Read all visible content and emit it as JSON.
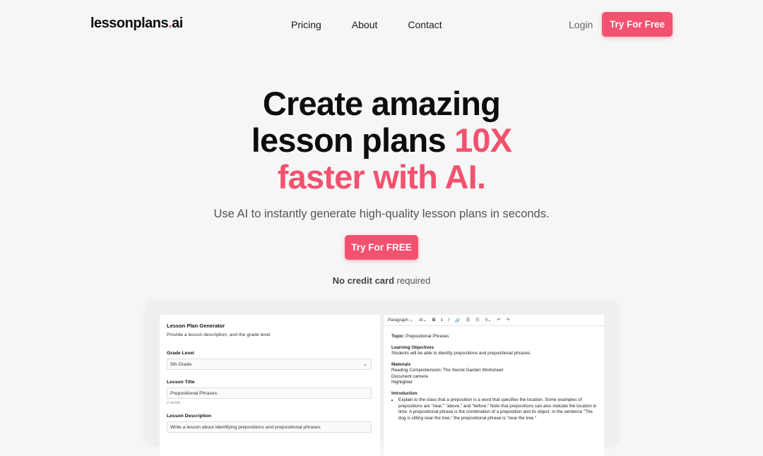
{
  "nav": {
    "logo": "lessonplans",
    "logo_dot": ".",
    "logo_suffix": "ai",
    "links": [
      "Pricing",
      "About",
      "Contact"
    ],
    "login": "Login",
    "cta": "Try For Free"
  },
  "hero": {
    "line1": "Create amazing",
    "line2": "lesson plans ",
    "accent1": "10X",
    "accent2": "faster with AI.",
    "subtitle": "Use AI to instantly generate high-quality lesson plans in seconds.",
    "cta": "Try For FREE",
    "note_bold": "No credit card",
    "note_rest": " required"
  },
  "colors": {
    "accent": "#f2526f"
  },
  "preview": {
    "form": {
      "title": "Lesson Plan Generator",
      "subtitle": "Provide a lesson description, and the grade level",
      "grade_label": "Grade Level",
      "grade_value": "5th Grade",
      "title_label": "Lesson Title",
      "title_value": "Prepositional Phrases",
      "word_count": "2 words",
      "desc_label": "Lesson Description",
      "desc_value": "Write a lesson about identifying prepositions and prepositional phrases"
    },
    "editor": {
      "toolbar": [
        "Paragraph",
        "AI",
        "B",
        "I",
        "I",
        "link-icon",
        "list-icon",
        "numbered-list-icon",
        "align-icon",
        "undo-icon",
        "redo-icon"
      ],
      "paragraph_label": "Paragraph",
      "ai_label": "AI",
      "topic_label": "Topic:",
      "topic_value": " Prepositional Phrases",
      "objectives_heading": "Learning Objectives",
      "objectives_text": "Students will be able to identify prepositions and prepositional phrases.",
      "materials_heading": "Materials",
      "materials": [
        "Reading Comprehension: The Secret Garden Worksheet",
        "Document camera",
        "Highlighter"
      ],
      "intro_heading": "Introduction",
      "intro_bullet": "Explain to the class that a preposition is a word that specifies the location. Some examples of prepositions are \"near,\" \"above,\" and \"before.\" Note that prepositions can also indicate the location in time. A prepositional phrase is the combination of a preposition and its object. In the sentence \"The dog is sitting near the tree,\" the prepositional phrase is \"near the tree.\""
    }
  }
}
